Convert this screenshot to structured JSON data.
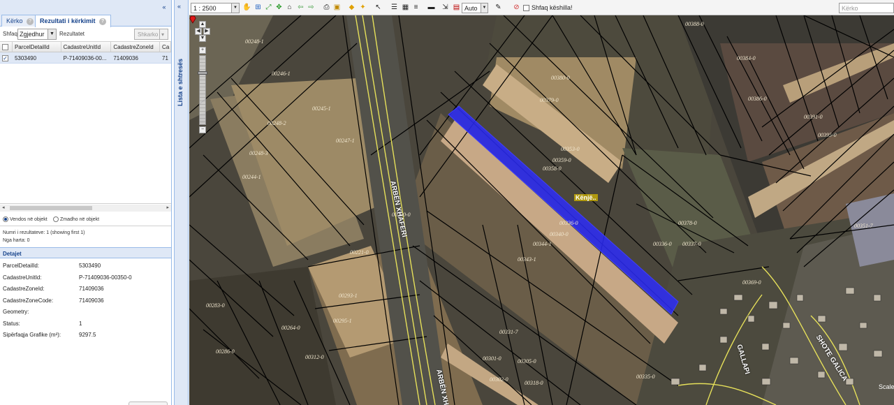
{
  "left_panel": {
    "collapse_symbol": "«",
    "tabs": [
      {
        "label": "Kërko"
      },
      {
        "label": "Rezultati i kërkimit"
      }
    ],
    "filter": {
      "show_label": "Shfaq",
      "show_value": "Zgjedhur",
      "results_label": "Rezultatet",
      "clear_button": "Shkarko"
    },
    "grid": {
      "columns": [
        "ParcelDetailId",
        "CadastreUnitId",
        "CadastreZoneId",
        "Ca"
      ],
      "rows": [
        {
          "checked": true,
          "cells": [
            "5303490",
            "P-71409036-00...",
            "71409036",
            "71"
          ]
        }
      ]
    },
    "radio_options": [
      {
        "label": "Vendos në objekt",
        "selected": true
      },
      {
        "label": "Zmadho në objekt",
        "selected": false
      }
    ],
    "counts": {
      "results": "Numri i rezultateve: 1 (showing first 1)",
      "on_map": "Nga harta: 0"
    },
    "details_title": "Detajet",
    "details": [
      {
        "key": "ParcelDetailId:",
        "value": "5303490"
      },
      {
        "key": "CadastreUnitId:",
        "value": "P-71409036-00350-0"
      },
      {
        "key": "CadastreZoneId:",
        "value": "71409036"
      },
      {
        "key": "CadastreZoneCode:",
        "value": "71409036"
      },
      {
        "key": "Geometry:",
        "value": ""
      },
      {
        "key": "Status:",
        "value": "1"
      },
      {
        "key": "Sipërfaqja Grafike (m²):",
        "value": "9297.5"
      }
    ]
  },
  "layer_strip": {
    "label": "Lista e shtresës",
    "toggle_symbol": "«"
  },
  "toolbar": {
    "scale": "1 : 2500",
    "zoom_mode": "Auto",
    "tips_label": "Shfaq këshilla!",
    "search_placeholder": "Kërko",
    "icons": [
      "pan-icon",
      "zoom-box-icon",
      "zoom-extent-icon",
      "full-extent-icon",
      "home-icon",
      "back-icon",
      "forward-icon",
      "print-icon",
      "save-icon",
      "identify-icon",
      "select-icon",
      "arrow-select-icon",
      "list-icon",
      "grid-icon",
      "layer-icon",
      "measure-icon",
      "draw-icon",
      "clear-icon"
    ]
  },
  "map": {
    "marker_label": "Kënjë..",
    "scale_label": "Scale",
    "road_labels": [
      "ARBËN XHAFERI",
      "ARBËN XH",
      "GALLAPI",
      "SHOTE GALICA"
    ],
    "parcel_labels": [
      "00248-2",
      "00248-3",
      "00244-1",
      "00246-1",
      "00245-1",
      "00247-1",
      "00248-1",
      "00379-0",
      "00380-0",
      "00353-0",
      "00359-0",
      "00358-0",
      "00336-0",
      "00340-0",
      "00343-1",
      "00344-1",
      "00378-0",
      "00336-0",
      "00337-0",
      "00369-0",
      "00388-0",
      "00384-0",
      "00386-0",
      "00391-0",
      "00395-0",
      "00351-7",
      "00283-0",
      "00286-0",
      "00295-1",
      "00293-1",
      "00264-0",
      "00312-0",
      "00331-7",
      "00301-0",
      "00302-0",
      "00305-0",
      "00318-0",
      "00335-0",
      "00221-0",
      "00290-0"
    ],
    "colors": {
      "selected_fill": "#2c2cff",
      "parcel_line": "#000000",
      "road_line": "#e6e05a"
    }
  }
}
